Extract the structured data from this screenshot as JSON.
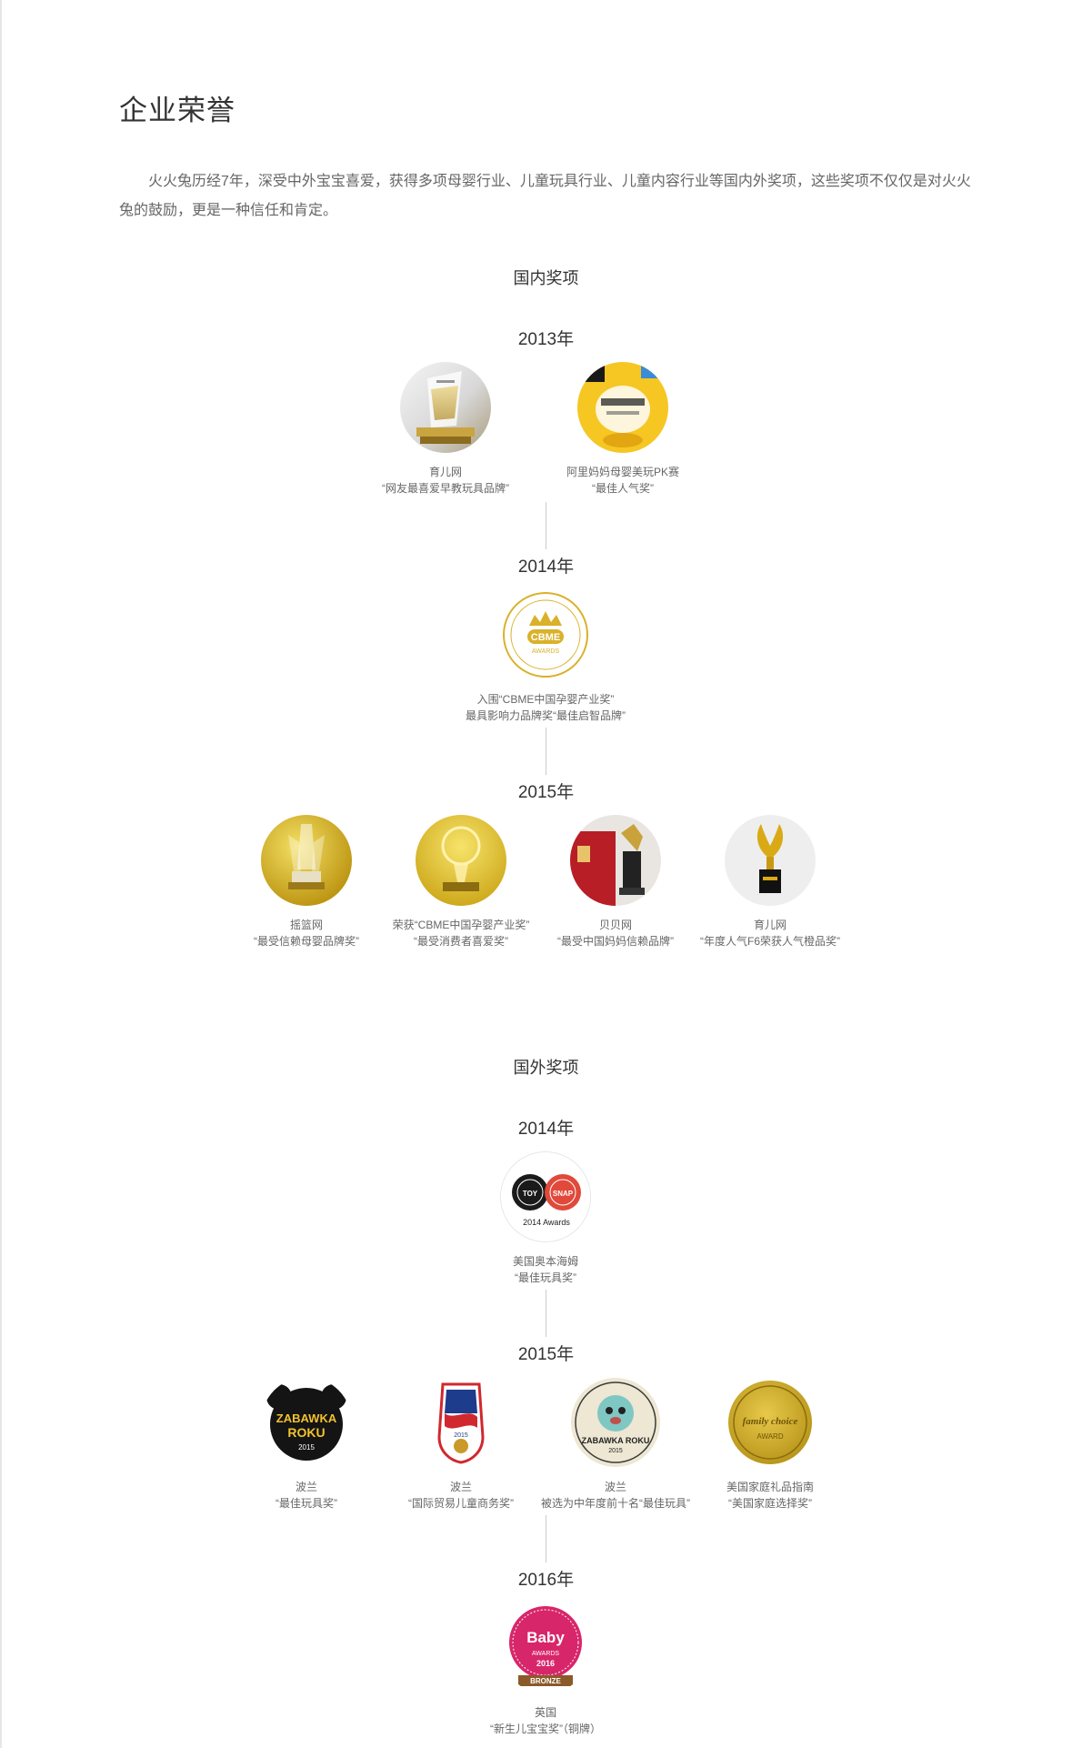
{
  "page": {
    "title": "企业荣誉",
    "intro": "火火兔历经7年，深受中外宝宝喜爱，获得多项母婴行业、儿童玩具行业、儿童内容行业等国内外奖项，这些奖项不仅仅是对火火兔的鼓励，更是一种信任和肯定。"
  },
  "domestic": {
    "title": "国内奖项",
    "y2013": {
      "year": "2013年",
      "awards": [
        {
          "name": "育儿网",
          "desc": "“网友最喜爱早教玩具品牌”",
          "icon": "crystal-trophy-icon"
        },
        {
          "name": "阿里妈妈母婴美玩PK赛",
          "desc": "“最佳人气奖”",
          "icon": "yellow-bunny-trophy-icon"
        }
      ]
    },
    "y2014": {
      "year": "2014年",
      "awards": [
        {
          "name": "入围“CBME中国孕婴产业奖”",
          "desc": "最具影响力品牌奖“最佳启智品牌”",
          "icon": "cbme-awards-badge-icon",
          "badge_main": "CBME",
          "badge_sub": "AWARDS"
        }
      ]
    },
    "y2015": {
      "year": "2015年",
      "awards": [
        {
          "name": "摇篮网",
          "desc": "“最受信赖母婴品牌奖”",
          "icon": "gold-trophy-icon"
        },
        {
          "name": "荣获“CBME中国孕婴产业奖”",
          "desc": "“最受消费者喜爱奖”",
          "icon": "cbme-gold-trophy-icon"
        },
        {
          "name": "贝贝网",
          "desc": "“最受中国妈妈信赖品牌”",
          "icon": "red-certificate-trophy-icon"
        },
        {
          "name": "育儿网",
          "desc": "“年度人气F6荣获人气橙品奖”",
          "icon": "golden-wing-trophy-icon"
        }
      ]
    }
  },
  "foreign": {
    "title": "国外奖项",
    "y2014": {
      "year": "2014年",
      "awards": [
        {
          "name": "美国奥本海姆",
          "desc": "“最佳玩具奖”",
          "icon": "toy-snap-awards-badge-icon",
          "badge_caption": "2014 Awards",
          "badge_left": "TOY",
          "badge_right": "SNAP"
        }
      ]
    },
    "y2015": {
      "year": "2015年",
      "awards": [
        {
          "name": "波兰",
          "desc": "“最佳玩具奖”",
          "icon": "zabawka-roku-badge-icon",
          "badge_main": "ZABAWKA",
          "badge_sub": "ROKU",
          "badge_year": "2015"
        },
        {
          "name": "波兰",
          "desc": "“国际贸易儿童商务奖”",
          "icon": "kids-biz-award-shield-icon",
          "badge_year": "2015"
        },
        {
          "name": "波兰",
          "desc": "被选为中年度前十名“最佳玩具”",
          "icon": "zabawka-roku-lion-badge-icon",
          "badge_main": "ZABAWKA ROKU",
          "badge_year": "2015"
        },
        {
          "name": "美国家庭礼品指南",
          "desc": "“美国家庭选择奖”",
          "icon": "family-choice-award-seal-icon",
          "badge_main": "family choice",
          "badge_sub": "AWARD"
        }
      ]
    },
    "y2016": {
      "year": "2016年",
      "awards": [
        {
          "name": "英国",
          "desc": "“新生儿宝宝奖”（铜牌）",
          "icon": "baby-pregnancy-awards-bronze-icon",
          "badge_main": "Baby",
          "badge_sub": "AWARDS",
          "badge_year": "2016",
          "badge_rank": "BRONZE"
        }
      ]
    }
  },
  "colors": {
    "gold": "#d9b12a",
    "text": "#333333",
    "muted": "#666666",
    "line": "#cccccc"
  }
}
